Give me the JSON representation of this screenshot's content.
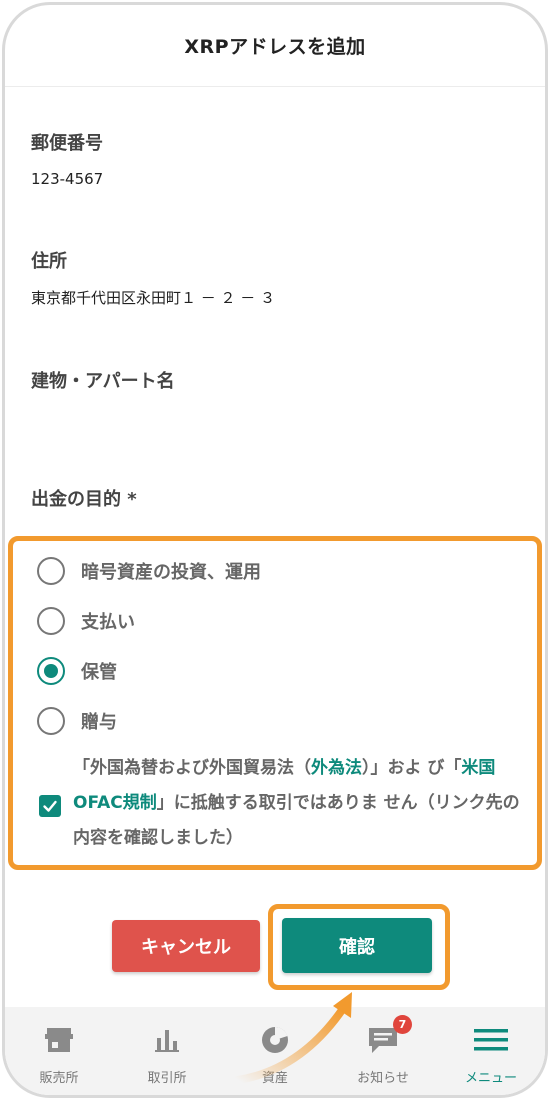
{
  "header": {
    "title": "XRPアドレスを追加"
  },
  "form": {
    "postal_code": {
      "label": "郵便番号",
      "value": "123-4567"
    },
    "address": {
      "label": "住所",
      "value": "東京都千代田区永田町１ － ２ － ３"
    },
    "building": {
      "label": "建物・アパート名",
      "value": ""
    },
    "purpose": {
      "label": "出金の目的 *",
      "options": [
        {
          "label": "暗号資産の投資、運用",
          "selected": false
        },
        {
          "label": "支払い",
          "selected": false
        },
        {
          "label": "保管",
          "selected": true
        },
        {
          "label": "贈与",
          "selected": false
        }
      ]
    },
    "consent": {
      "checked": true,
      "text_1": "「外国為替および外国貿易法（",
      "link_1": "外為法",
      "text_2": "）」およ び「",
      "link_2": "米国OFAC規制",
      "text_3": "」に抵触する取引ではありま せん（リンク先の内容を確認しました）"
    }
  },
  "buttons": {
    "cancel": "キャンセル",
    "confirm": "確認"
  },
  "tabbar": {
    "items": [
      {
        "label": "販売所",
        "icon": "shop-icon",
        "active": false
      },
      {
        "label": "取引所",
        "icon": "bar-chart-icon",
        "active": false
      },
      {
        "label": "資産",
        "icon": "pie-chart-icon",
        "active": false
      },
      {
        "label": "お知らせ",
        "icon": "message-icon",
        "active": false,
        "badge": "7"
      },
      {
        "label": "メニュー",
        "icon": "menu-icon",
        "active": true
      }
    ]
  },
  "colors": {
    "accent": "#0e8a7c",
    "highlight": "#f29a2e",
    "cancel": "#df534c",
    "badge": "#e0453c"
  }
}
